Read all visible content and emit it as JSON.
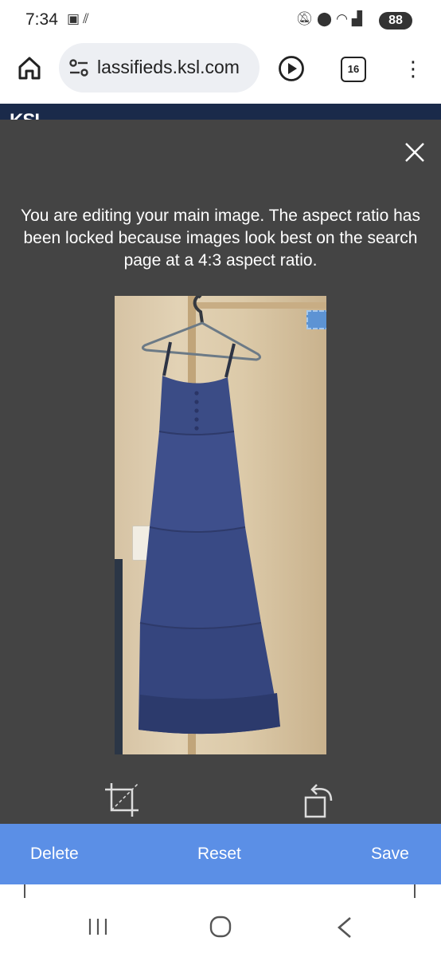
{
  "status_bar": {
    "time": "7:34",
    "left_icons": [
      "screenshot-icon",
      "data-saver-icon"
    ],
    "right_icons": [
      "mute-icon",
      "location-icon",
      "wifi-icon",
      "signal-icon"
    ],
    "battery": "88"
  },
  "browser": {
    "url": "lassifieds.ksl.com",
    "tab_count": "16"
  },
  "page_behind": {
    "logo": "KSL"
  },
  "modal": {
    "instruction": "You are editing your main image. The aspect ratio has been locked because images look best on the search page at a 4:3 aspect ratio.",
    "tools": [
      "crop-icon",
      "rotate-icon"
    ],
    "actions": {
      "delete": "Delete",
      "reset": "Reset",
      "save": "Save"
    },
    "overlay_color": "#444444",
    "action_bar_color": "#5b8fe6"
  },
  "nav_bar": {
    "icons": [
      "recent-apps-icon",
      "home-icon",
      "back-icon"
    ]
  }
}
